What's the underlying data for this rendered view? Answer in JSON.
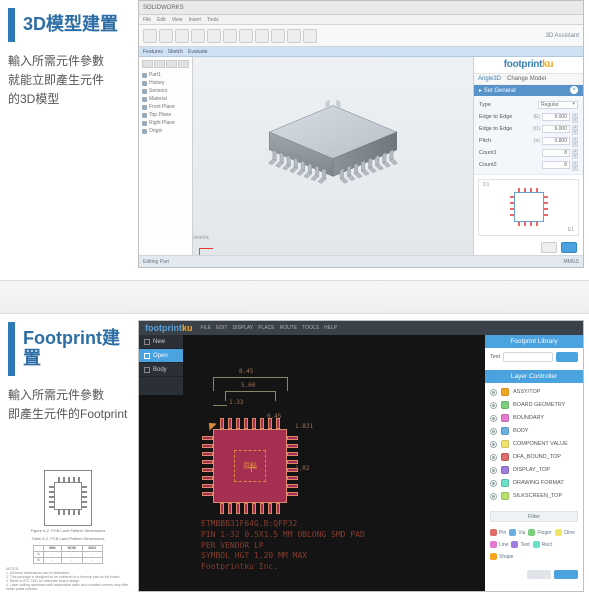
{
  "section1": {
    "title": "3D模型建置",
    "desc_l1": "輸入所需元件參數",
    "desc_l2": "就能立即產生元件",
    "desc_l3": "的3D模型"
  },
  "section2": {
    "title": "Footprint建置",
    "desc_l1": "輸入所需元件參數",
    "desc_l2": "即產生元件的Footprint"
  },
  "sw": {
    "app_label": "SOLIDWORKS",
    "tab_label": "3D Assistant",
    "brand": "footprint",
    "brand_suffix": "ku",
    "side_tabs": {
      "a": "Angle3D",
      "b": "Change Model"
    },
    "panel_title": "Set General",
    "rows": {
      "type_label": "Type",
      "type_value": "Regular",
      "e2e_label": "Edge to Edge",
      "e2e_val": "9.000",
      "e2ed_label": "Edge to Edge",
      "e2ed_val": "9.000",
      "pitch_label": "Pitch",
      "pitch_val": "0.800",
      "count1_label": "Count1",
      "count1_val": "8",
      "count2_label": "Count2",
      "count2_val": "8"
    },
    "prev_labels": {
      "d1": "D1",
      "e1": "E1"
    },
    "status": {
      "a": "Editing Part",
      "b": "MMGS"
    }
  },
  "eda": {
    "brand_f": "footprint",
    "brand_ku": "ku",
    "menus": [
      "FILE",
      "EDIT",
      "DISPLAY",
      "PLACE",
      "ROUTE",
      "TOOLS",
      "HELP"
    ],
    "tabs": {
      "new": "New",
      "open": "Open",
      "body": "Body"
    },
    "side": {
      "lib_title": "Footprint Library",
      "lib_label": "Text",
      "layer_title": "Layer Controller",
      "layers": [
        {
          "name": "ASSY/TOP",
          "color": "#f5a623"
        },
        {
          "name": "BOARD GEOMETRY",
          "color": "#7cd07c"
        },
        {
          "name": "BOUNDARY",
          "color": "#e47ad1"
        },
        {
          "name": "BODY",
          "color": "#6bb1e0"
        },
        {
          "name": "COMPONENT VALUE",
          "color": "#f1e36a"
        },
        {
          "name": "DFA_BOUND_TOP",
          "color": "#e06b6b"
        },
        {
          "name": "DISPLAY_TOP",
          "color": "#a07be0"
        },
        {
          "name": "DRAWING FORMAT",
          "color": "#6be0c9"
        },
        {
          "name": "SILKSCREEN_TOP",
          "color": "#b6e06b"
        }
      ],
      "filter_title": "Filter",
      "filters": [
        {
          "name": "Pin",
          "color": "#e06b6b"
        },
        {
          "name": "Via",
          "color": "#6bb1e0"
        },
        {
          "name": "Finger",
          "color": "#7cd07c"
        },
        {
          "name": "Cline",
          "color": "#f1e36a"
        },
        {
          "name": "Line",
          "color": "#e47ad1"
        },
        {
          "name": "Text",
          "color": "#a07be0"
        },
        {
          "name": "Rect",
          "color": "#6be0c9"
        },
        {
          "name": "Shape",
          "color": "#f5a623"
        }
      ]
    },
    "fp": {
      "core_label": "原點",
      "dims": {
        "d1": "8.45",
        "d2": "5.60",
        "d3": "1.33",
        "d4": "0.45",
        "d5": "1.831",
        "d6": "1.02"
      },
      "text_l1": "ETMBBB31F64G.B:QFP32",
      "text_l2": "PIN 1-32 0.5X1.5 MM OBLONG SMD PAD",
      "text_l3": "PER VENDOR LP",
      "text_l4": "SYMBOL HGT 1.20 MM MAX",
      "text_l5": "Footprintku Inc."
    }
  },
  "ref": {
    "caption": "Figure 6-2. PCB Land Pattern Dimensions",
    "tcaption": "Table 6-2. PCB Land Pattern Dimensions",
    "notes": "NOTES:\n1. All linear dimensions are in millimeters.\n2. This package is designed to be soldered to a thermal pad on the board.\n3. Refer to IPC-7351 for alternate board design.\n4. Laser cutting apertures with trapezoidal walls and rounded corners may offer better paste release."
  }
}
